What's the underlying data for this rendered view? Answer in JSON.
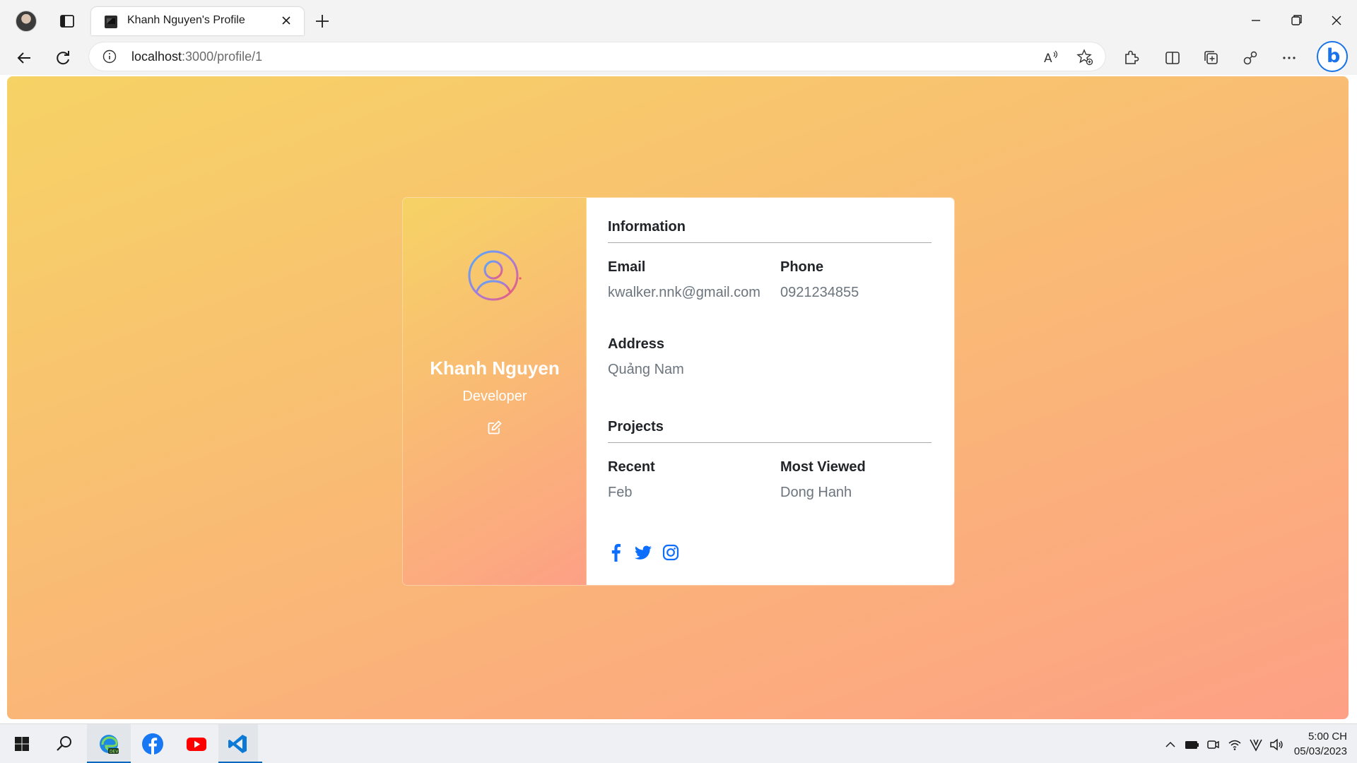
{
  "browser": {
    "tab_title": "Khanh Nguyen's Profile",
    "url_host": "localhost",
    "url_path": ":3000/profile/1"
  },
  "profile": {
    "name": "Khanh Nguyen",
    "role": "Developer"
  },
  "information": {
    "heading": "Information",
    "email_label": "Email",
    "email_value": "kwalker.nnk@gmail.com",
    "phone_label": "Phone",
    "phone_value": "0921234855",
    "address_label": "Address",
    "address_value": "Quảng Nam"
  },
  "projects": {
    "heading": "Projects",
    "recent_label": "Recent",
    "recent_value": "Feb",
    "most_viewed_label": "Most Viewed",
    "most_viewed_value": "Dong Hanh"
  },
  "social": [
    "facebook-icon",
    "twitter-icon",
    "instagram-icon"
  ],
  "bing": {
    "letter": "b"
  },
  "taskbar": {
    "apps": [
      "windows-start-icon",
      "search-icon",
      "edge-dev-icon",
      "facebook-icon",
      "youtube-icon",
      "vscode-icon"
    ],
    "time": "5:00 CH",
    "date": "05/03/2023"
  },
  "colors": {
    "gradient_start": "#f6d365",
    "gradient_end": "#fda085",
    "social_blue": "#0d6efd",
    "label_color": "#212529",
    "value_color": "#6c757d"
  }
}
